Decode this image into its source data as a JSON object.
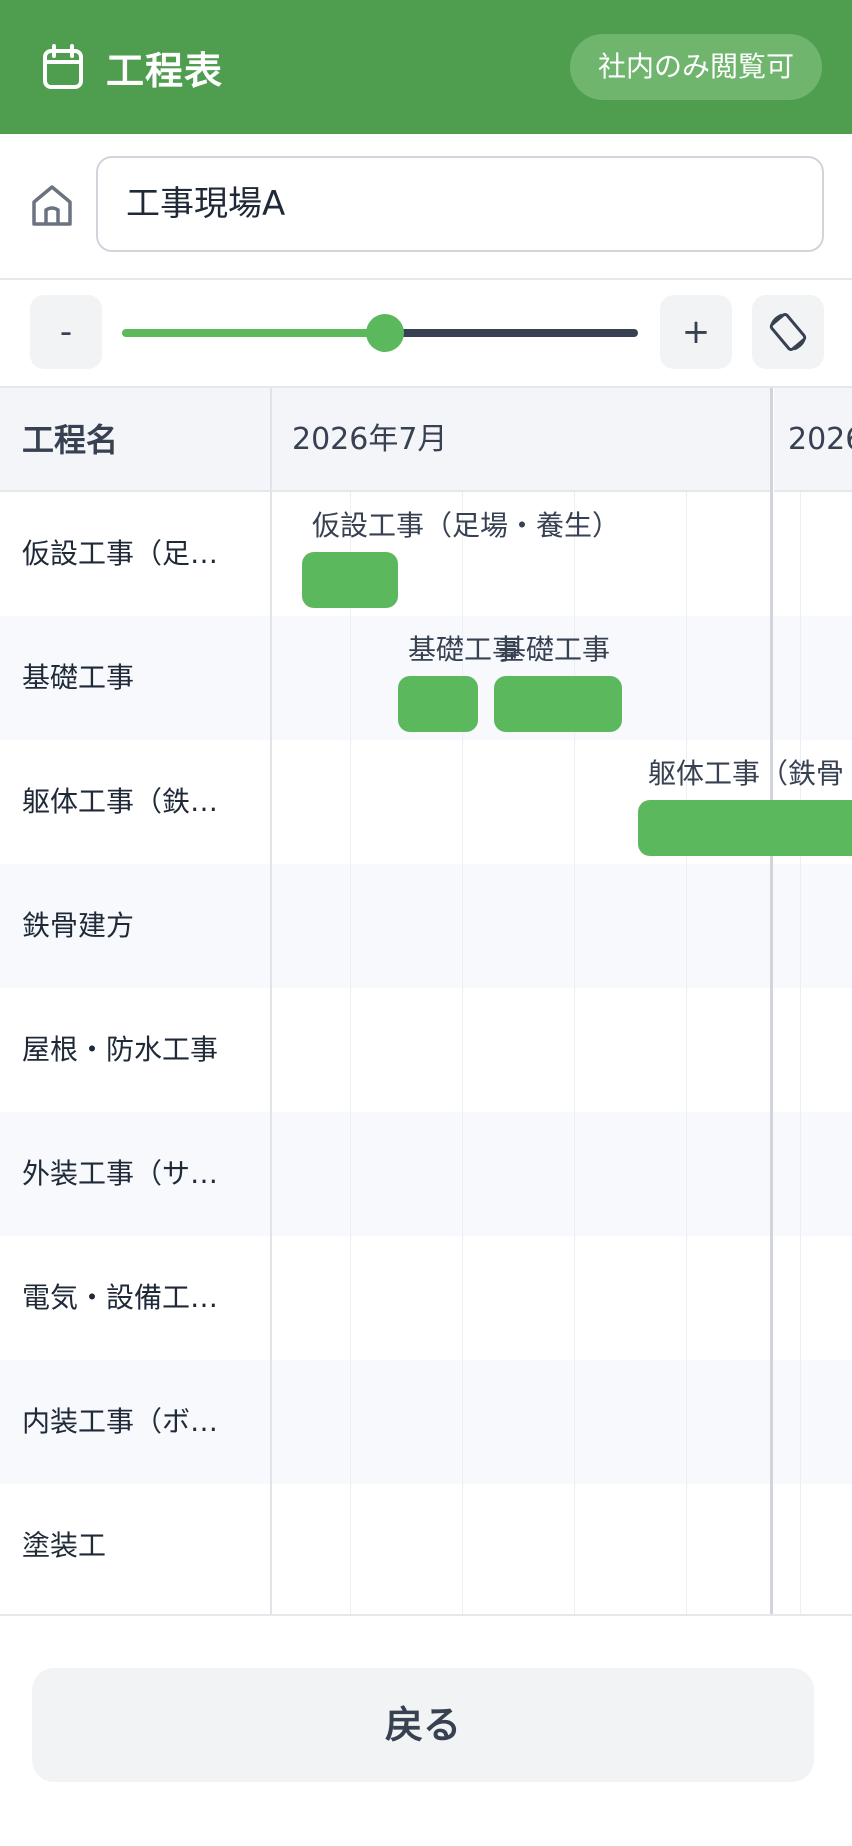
{
  "header": {
    "title": "工程表",
    "visibility_badge": "社内のみ閲覧可",
    "icon": "calendar-icon",
    "color": "#4f9d4f"
  },
  "site": {
    "icon": "home-icon",
    "value": "工事現場A"
  },
  "zoom": {
    "minus_label": "-",
    "plus_label": "+",
    "rotate_icon": "rotate-screen-icon",
    "level": 0.52
  },
  "gantt": {
    "name_header": "工程名",
    "months": [
      "2026年7月",
      "2026"
    ],
    "tasks": [
      {
        "name": "仮設工事（足…",
        "label": "仮設工事（足場・養生）"
      },
      {
        "name": "基礎工事",
        "label": "基礎工事",
        "label2": "基礎工事"
      },
      {
        "name": "躯体工事（鉄…",
        "label": "躯体工事（鉄骨"
      },
      {
        "name": "鉄骨建方"
      },
      {
        "name": "屋根・防水工事"
      },
      {
        "name": "外装工事（サ…"
      },
      {
        "name": "電気・設備工…"
      },
      {
        "name": "内装工事（ボ…"
      },
      {
        "name": "塗装工"
      }
    ],
    "bar_color": "#5cb85c"
  },
  "footer": {
    "back_label": "戻る"
  }
}
